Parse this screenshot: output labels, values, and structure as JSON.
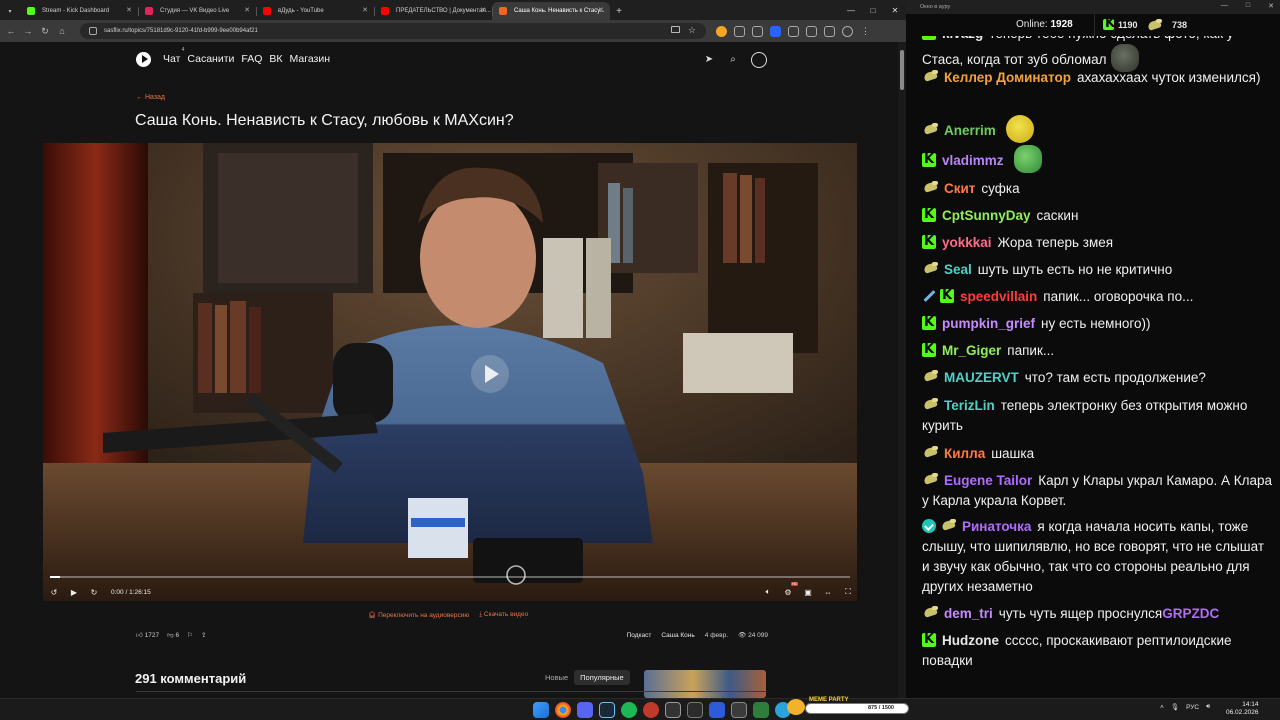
{
  "browser": {
    "tabs": [
      {
        "title": "Stream - Kick Dashboard",
        "favicon_color": "#53fc18"
      },
      {
        "title": "Студия — VK Видео Live",
        "favicon_color": "#e0245e"
      },
      {
        "title": "вДудь - YouTube",
        "favicon_color": "#ff0000"
      },
      {
        "title": "ПРЕДАТЕЛЬСТВО | Документал...",
        "favicon_color": "#ff0000"
      },
      {
        "title": "Саша Конь. Ненависть к Стасу...",
        "favicon_color": "#f26522",
        "active": true
      }
    ],
    "url": "sasflix.ru/topics/75181d9c-9120-41fd-b999-9ee00b94af21"
  },
  "site": {
    "nav": [
      {
        "label": "Чат",
        "badge": "4"
      },
      {
        "label": "Сасанити"
      },
      {
        "label": "FAQ"
      },
      {
        "label": "ВК"
      },
      {
        "label": "Магазин"
      }
    ],
    "back_label": "← Назад",
    "video_title": "Саша Конь. Ненависть к Стасу, любовь к МАХсин?",
    "player": {
      "time": "0:00 / 1:26:15",
      "progress": 0.012,
      "settings_badge": "HD"
    },
    "audio_link": "Переключить на аудиоверсию",
    "download_link": "Скачать видео",
    "likes": "1727",
    "dislikes": "6",
    "category": "Подкаст",
    "author": "Саша Конь",
    "date": "4 февр.",
    "views": "24 099",
    "comments_title": "291 комментарий",
    "sort": [
      "Новые",
      "Популярные"
    ]
  },
  "chat": {
    "window_title": "Окно в ауру",
    "online_label": "Online:",
    "online_count": "1928",
    "kick_count": "1190",
    "coin_count": "738",
    "messages": [
      {
        "badges": [
          "kick"
        ],
        "user": "kivazg",
        "color": "#e6e6e6",
        "text": "теперь тебе нужно сделать фото, как у Стаса, когда тот зуб обломал",
        "emote": "stone"
      },
      {
        "badges": [
          "pickle"
        ],
        "user": "Келлер Доминатор",
        "color": "#f2a33a",
        "text": "ахахаххаах чуток изменился)"
      },
      {
        "badges": [
          "pickle"
        ],
        "user": "Anerrim",
        "color": "#6fce5a",
        "text": "",
        "emote": "dog"
      },
      {
        "badges": [
          "kick"
        ],
        "user": "vladimmz",
        "color": "#b785f5",
        "text": "",
        "emote": "frog"
      },
      {
        "badges": [
          "pickle"
        ],
        "user": "Скит",
        "color": "#ff7a45",
        "text": "суфка"
      },
      {
        "badges": [
          "kick"
        ],
        "user": "CptSunnyDay",
        "color": "#8ff05a",
        "text": "саскин"
      },
      {
        "badges": [
          "kick"
        ],
        "user": "yokkkai",
        "color": "#ff6b8a",
        "text": "Жора теперь змея"
      },
      {
        "badges": [
          "pickle"
        ],
        "user": "Seal",
        "color": "#4fd1c5",
        "text": "шуть шуть есть но не критично"
      },
      {
        "badges": [
          "sword",
          "kick"
        ],
        "user": "speedvillain",
        "color": "#ff3b3b",
        "text": "папик... оговорочка по..."
      },
      {
        "badges": [
          "kick"
        ],
        "user": "pumpkin_grief",
        "color": "#c68cff",
        "text": "ну есть немного))"
      },
      {
        "badges": [
          "kick"
        ],
        "user": "Mr_Giger",
        "color": "#8ff05a",
        "text": "папик..."
      },
      {
        "badges": [
          "pickle"
        ],
        "user": "MAUZERVT",
        "color": "#4fd1c5",
        "text": "что? там есть продолжение?"
      },
      {
        "badges": [
          "pickle"
        ],
        "user": "TerizLin",
        "color": "#4fd1c5",
        "text": "теперь электронку без открытия можно курить"
      },
      {
        "badges": [
          "pickle"
        ],
        "user": "Килла",
        "color": "#ff7a45",
        "text": "шашка"
      },
      {
        "badges": [
          "pickle"
        ],
        "user": "Eugene Tailor",
        "color": "#b06cff",
        "text": "Карл у Клары украл Камаро. А Клара у Карла украла Корвет."
      },
      {
        "badges": [
          "verified",
          "pickle"
        ],
        "user": "Ринаточка",
        "color": "#b06cff",
        "text": "я когда начала носить капы, тоже слышу, что шипилявлю, но все говорят, что не слышат и звучу как обычно, так что со стороны реально для других незаметно"
      },
      {
        "badges": [
          "pickle"
        ],
        "user": "dem_tri",
        "color": "#c68cff",
        "text": "чуть чуть ящер проснулся",
        "tail": "GRPZDC",
        "tail_color": "#b06cff"
      },
      {
        "badges": [
          "kick"
        ],
        "user": "Hudzone",
        "color": "#e6e6e6",
        "text": "ссссс, проскакивают рептилоидские повадки"
      }
    ]
  },
  "taskbar": {
    "widget_label": "MEME PARTY",
    "widget_value": "875 / 1500",
    "lang": "РУС",
    "time": "14:14",
    "date": "06.02.2026"
  }
}
